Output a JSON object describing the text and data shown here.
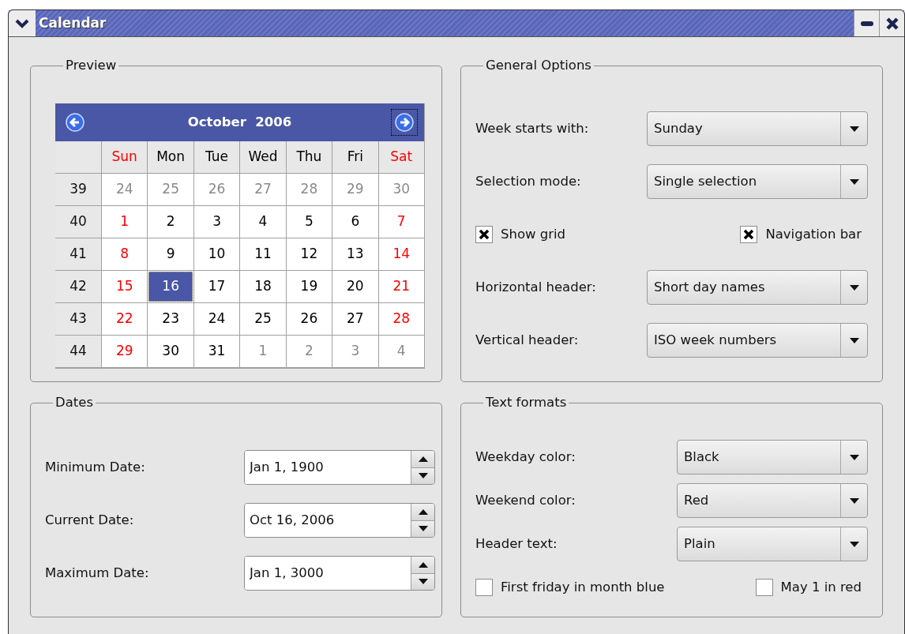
{
  "window": {
    "title": "Calendar"
  },
  "preview": {
    "title": "Preview",
    "calendar": {
      "month_label": "October  2006",
      "header": [
        {
          "text": "Sun",
          "kind": "weekend"
        },
        {
          "text": "Mon",
          "kind": "weekday"
        },
        {
          "text": "Tue",
          "kind": "weekday"
        },
        {
          "text": "Wed",
          "kind": "weekday"
        },
        {
          "text": "Thu",
          "kind": "weekday"
        },
        {
          "text": "Fri",
          "kind": "weekday"
        },
        {
          "text": "Sat",
          "kind": "weekend"
        }
      ],
      "weeks": [
        {
          "number": "39",
          "days": [
            {
              "text": "24",
              "kind": "other",
              "selected": false
            },
            {
              "text": "25",
              "kind": "other",
              "selected": false
            },
            {
              "text": "26",
              "kind": "other",
              "selected": false
            },
            {
              "text": "27",
              "kind": "other",
              "selected": false
            },
            {
              "text": "28",
              "kind": "other",
              "selected": false
            },
            {
              "text": "29",
              "kind": "other",
              "selected": false
            },
            {
              "text": "30",
              "kind": "other",
              "selected": false
            }
          ]
        },
        {
          "number": "40",
          "days": [
            {
              "text": "1",
              "kind": "weekend",
              "selected": false
            },
            {
              "text": "2",
              "kind": "weekday",
              "selected": false
            },
            {
              "text": "3",
              "kind": "weekday",
              "selected": false
            },
            {
              "text": "4",
              "kind": "weekday",
              "selected": false
            },
            {
              "text": "5",
              "kind": "weekday",
              "selected": false
            },
            {
              "text": "6",
              "kind": "weekday",
              "selected": false
            },
            {
              "text": "7",
              "kind": "weekend",
              "selected": false
            }
          ]
        },
        {
          "number": "41",
          "days": [
            {
              "text": "8",
              "kind": "weekend",
              "selected": false
            },
            {
              "text": "9",
              "kind": "weekday",
              "selected": false
            },
            {
              "text": "10",
              "kind": "weekday",
              "selected": false
            },
            {
              "text": "11",
              "kind": "weekday",
              "selected": false
            },
            {
              "text": "12",
              "kind": "weekday",
              "selected": false
            },
            {
              "text": "13",
              "kind": "weekday",
              "selected": false
            },
            {
              "text": "14",
              "kind": "weekend",
              "selected": false
            }
          ]
        },
        {
          "number": "42",
          "days": [
            {
              "text": "15",
              "kind": "weekend",
              "selected": false
            },
            {
              "text": "16",
              "selected": true
            },
            {
              "text": "17",
              "kind": "weekday",
              "selected": false
            },
            {
              "text": "18",
              "kind": "weekday",
              "selected": false
            },
            {
              "text": "19",
              "kind": "weekday",
              "selected": false
            },
            {
              "text": "20",
              "kind": "weekday",
              "selected": false
            },
            {
              "text": "21",
              "kind": "weekend",
              "selected": false
            }
          ]
        },
        {
          "number": "43",
          "days": [
            {
              "text": "22",
              "kind": "weekend",
              "selected": false
            },
            {
              "text": "23",
              "kind": "weekday",
              "selected": false
            },
            {
              "text": "24",
              "kind": "weekday",
              "selected": false
            },
            {
              "text": "25",
              "kind": "weekday",
              "selected": false
            },
            {
              "text": "26",
              "kind": "weekday",
              "selected": false
            },
            {
              "text": "27",
              "kind": "weekday",
              "selected": false
            },
            {
              "text": "28",
              "kind": "weekend",
              "selected": false
            }
          ]
        },
        {
          "number": "44",
          "days": [
            {
              "text": "29",
              "kind": "weekend",
              "selected": false
            },
            {
              "text": "30",
              "kind": "weekday",
              "selected": false
            },
            {
              "text": "31",
              "kind": "weekday",
              "selected": false
            },
            {
              "text": "1",
              "kind": "other",
              "selected": false
            },
            {
              "text": "2",
              "kind": "other",
              "selected": false
            },
            {
              "text": "3",
              "kind": "other",
              "selected": false
            },
            {
              "text": "4",
              "kind": "other",
              "selected": false
            }
          ]
        }
      ]
    }
  },
  "general_options": {
    "title": "General Options",
    "rows": [
      {
        "kind": "combo",
        "label": "Week starts with:",
        "value": "Sunday"
      },
      {
        "kind": "combo",
        "label": "Selection mode:",
        "value": "Single selection"
      },
      {
        "kind": "checks",
        "items": [
          {
            "label": "Show grid",
            "checked": true
          },
          {
            "label": "Navigation bar",
            "checked": true
          }
        ]
      },
      {
        "kind": "combo",
        "label": "Horizontal header:",
        "value": "Short day names"
      },
      {
        "kind": "combo",
        "label": "Vertical header:",
        "value": "ISO week numbers"
      }
    ]
  },
  "dates": {
    "title": "Dates",
    "fields": [
      {
        "label": "Minimum Date:",
        "value": "Jan 1, 1900"
      },
      {
        "label": "Current Date:",
        "value": "Oct 16, 2006"
      },
      {
        "label": "Maximum Date:",
        "value": "Jan 1, 3000"
      }
    ]
  },
  "text_formats": {
    "title": "Text formats",
    "rows": [
      {
        "kind": "combo",
        "label": "Weekday color:",
        "value": "Black"
      },
      {
        "kind": "combo",
        "label": "Weekend color:",
        "value": "Red"
      },
      {
        "kind": "combo",
        "label": "Header text:",
        "value": "Plain"
      },
      {
        "kind": "checks",
        "items": [
          {
            "label": "First friday in month blue",
            "checked": false
          },
          {
            "label": "May 1 in red",
            "checked": false
          }
        ]
      }
    ]
  }
}
